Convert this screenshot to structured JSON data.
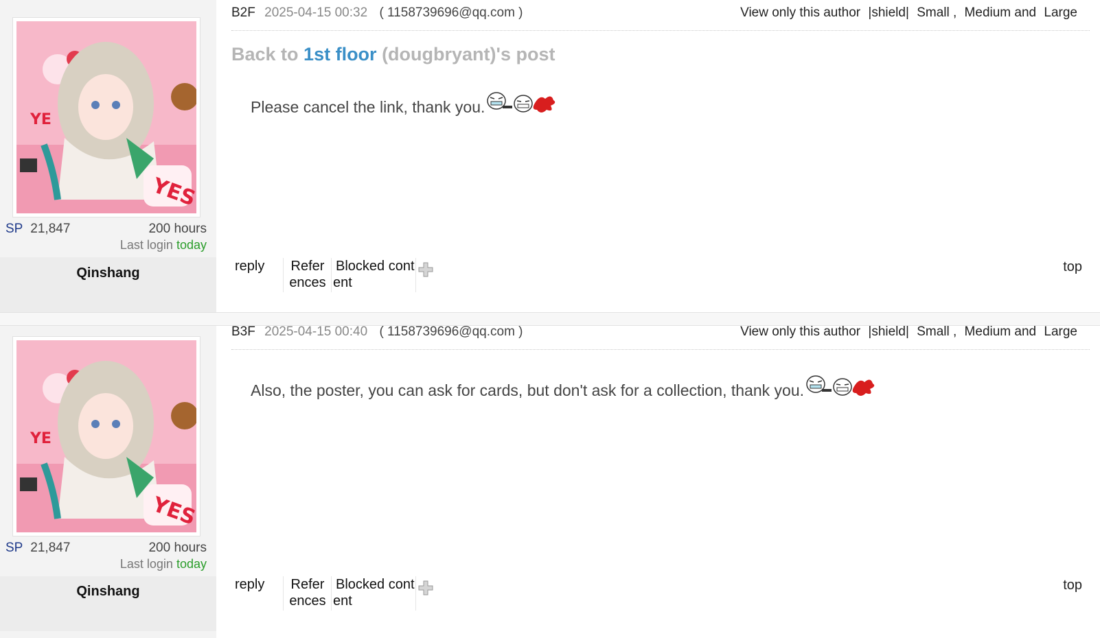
{
  "posts": [
    {
      "floor": "B2F",
      "date": "2025-04-15 00:32",
      "email": "( 1158739696@qq.com )",
      "tools": [
        "View only this author",
        "|shield|",
        "Small ,",
        "Medium and",
        "Large"
      ],
      "back_prefix": "Back to ",
      "back_link": "1st floor",
      "back_suffix": " (dougbryant)'s post",
      "content": "Please cancel the link, thank you.",
      "user": {
        "sp_label": "SP",
        "sp_value": "21,847",
        "hours": "200 hours",
        "login_prefix": "Last login ",
        "login_when": "today",
        "name": "Qinshang"
      },
      "actions": {
        "reply": "reply",
        "refer1": "Refer",
        "refer2": "ences",
        "blocked1": "Blocked cont",
        "blocked2": "ent",
        "top": "top"
      }
    },
    {
      "floor": "B3F",
      "date": "2025-04-15 00:40",
      "email": "( 1158739696@qq.com )",
      "tools": [
        "View only this author",
        "|shield|",
        "Small ,",
        "Medium and",
        "Large"
      ],
      "content": "Also, the poster, you can ask for cards, but don't ask for a collection, thank you.",
      "user": {
        "sp_label": "SP",
        "sp_value": "21,847",
        "hours": "200 hours",
        "login_prefix": "Last login ",
        "login_when": "today",
        "name": "Qinshang"
      },
      "actions": {
        "reply": "reply",
        "refer1": "Refer",
        "refer2": "ences",
        "blocked1": "Blocked cont",
        "blocked2": "ent",
        "top": "top"
      }
    }
  ],
  "icons": {
    "emoticon": "laughing-gun-blood-emoticon",
    "expand": "plus-icon"
  }
}
